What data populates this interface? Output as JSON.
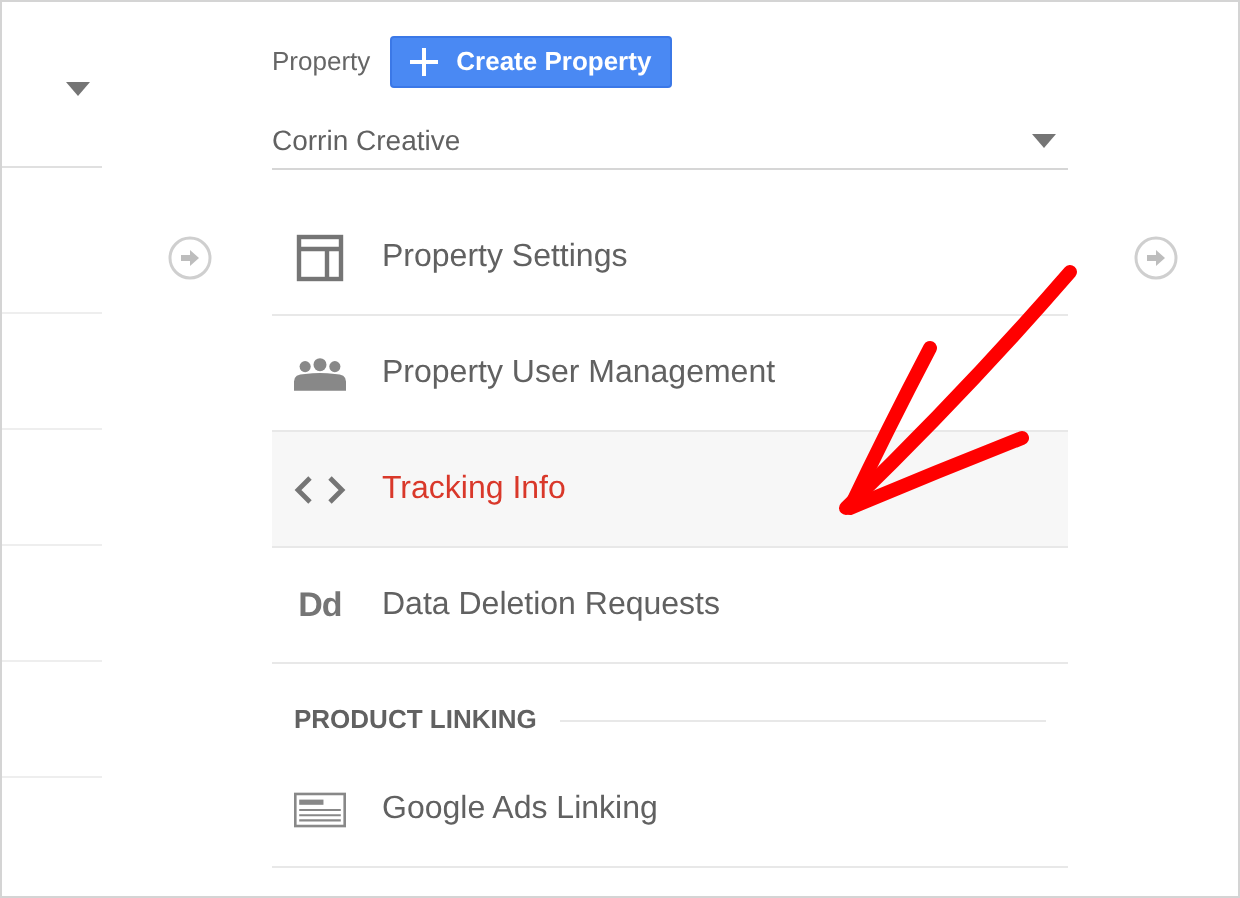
{
  "property_header": {
    "label": "Property",
    "create_button": "Create Property"
  },
  "property_select": {
    "value": "Corrin Creative"
  },
  "menu_items": [
    {
      "kind": "settings",
      "label": "Property Settings",
      "selected": false
    },
    {
      "kind": "users",
      "label": "Property User Management",
      "selected": false
    },
    {
      "kind": "code",
      "label": "Tracking Info",
      "selected": true
    },
    {
      "kind": "deletion",
      "label": "Data Deletion Requests",
      "icon_text": "Dd",
      "selected": false
    }
  ],
  "product_linking": {
    "heading": "PRODUCT LINKING",
    "items": [
      {
        "kind": "ads",
        "label": "Google Ads Linking",
        "selected": false
      }
    ]
  }
}
